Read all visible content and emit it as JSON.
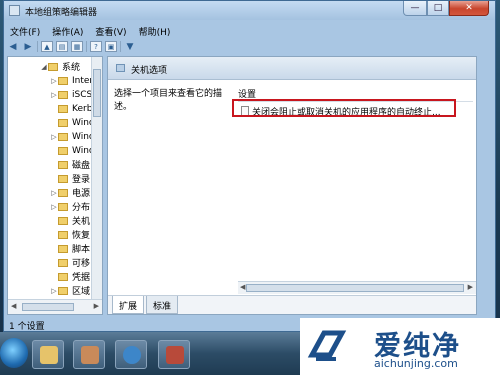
{
  "window": {
    "title": "本地组策略编辑器",
    "min": "—",
    "max": "□",
    "close": "✕"
  },
  "menu": [
    {
      "label": "文件(F)"
    },
    {
      "label": "操作(A)"
    },
    {
      "label": "查看(V)"
    },
    {
      "label": "帮助(H)"
    }
  ],
  "tree": {
    "items": [
      {
        "label": "系统",
        "twisty": "◢"
      },
      {
        "label": "Inter",
        "twisty": "▷"
      },
      {
        "label": "iSCSI",
        "twisty": "▷"
      },
      {
        "label": "Kerb",
        "twisty": ""
      },
      {
        "label": "Winc",
        "twisty": ""
      },
      {
        "label": "Winc",
        "twisty": "▷"
      },
      {
        "label": "Winc",
        "twisty": ""
      },
      {
        "label": "磁盘",
        "twisty": ""
      },
      {
        "label": "登录",
        "twisty": ""
      },
      {
        "label": "电源",
        "twisty": "▷"
      },
      {
        "label": "分布",
        "twisty": "▷"
      },
      {
        "label": "关机",
        "twisty": ""
      },
      {
        "label": "恢复",
        "twisty": ""
      },
      {
        "label": "脚本",
        "twisty": ""
      },
      {
        "label": "可移",
        "twisty": ""
      },
      {
        "label": "凭据",
        "twisty": ""
      },
      {
        "label": "区域",
        "twisty": "▷"
      },
      {
        "label": "驱动",
        "twisty": "▷"
      }
    ]
  },
  "content": {
    "header": "关机选项",
    "description": "选择一个项目来查看它的描述。",
    "column_header": "设置",
    "settings": [
      {
        "label": "关闭会阻止或取消关机的应用程序的自动终止..."
      }
    ]
  },
  "tabs": [
    {
      "label": "扩展"
    },
    {
      "label": "标准"
    }
  ],
  "status": "1 个设置",
  "watermark": {
    "title": "爱纯净",
    "url": "aichunjing.com"
  },
  "colors": {
    "highlight_box": "#c8161e",
    "watermark_text": "#1d4f8a"
  }
}
